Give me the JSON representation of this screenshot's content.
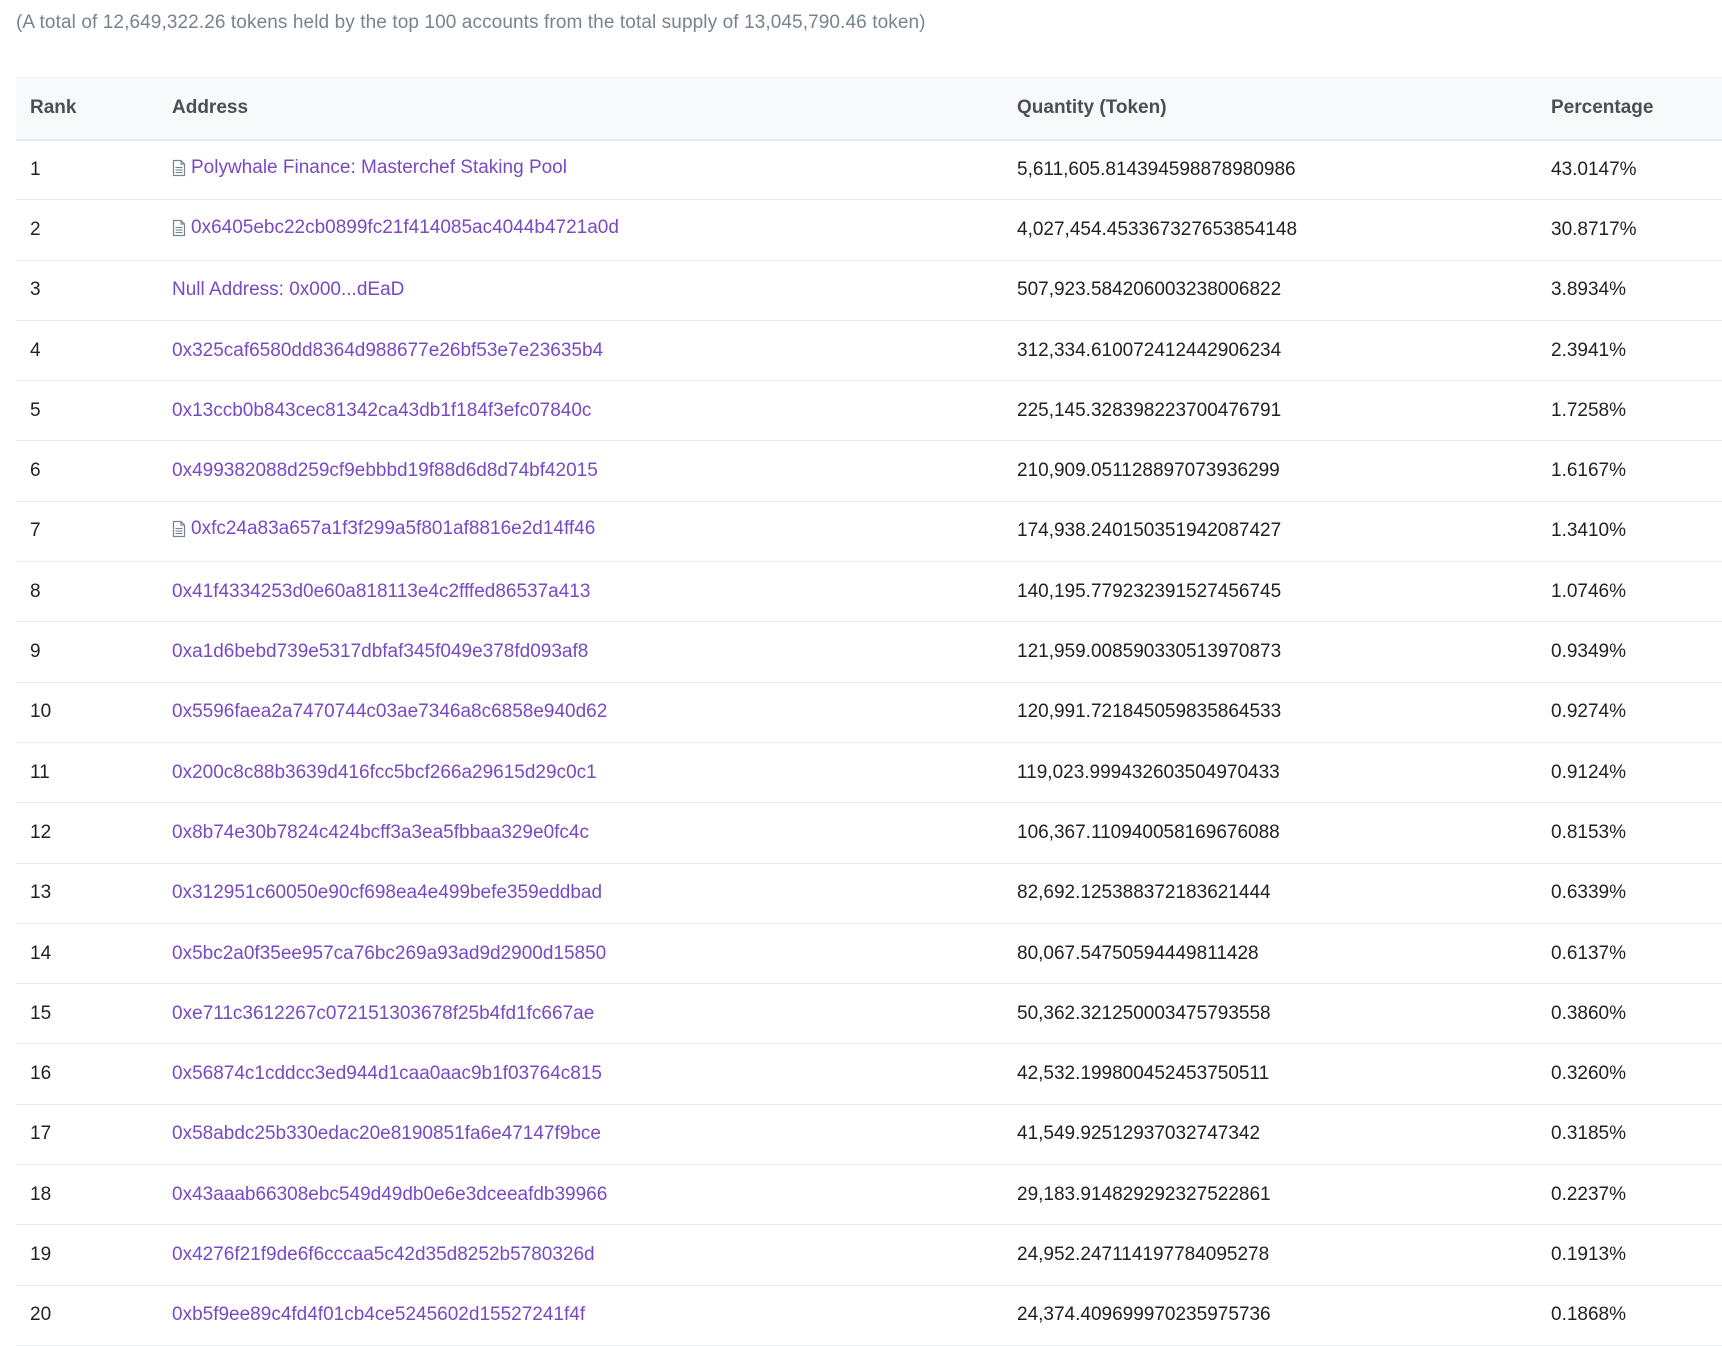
{
  "summary": "(A total of 12,649,322.26 tokens held by the top 100 accounts from the total supply of 13,045,790.46 token)",
  "table": {
    "headers": {
      "rank": "Rank",
      "address": "Address",
      "quantity": "Quantity (Token)",
      "percentage": "Percentage"
    },
    "rows": [
      {
        "rank": "1",
        "address": "Polywhale Finance: Masterchef Staking Pool",
        "contract": true,
        "quantity": "5,611,605.814394598878980986",
        "percentage": "43.0147%"
      },
      {
        "rank": "2",
        "address": "0x6405ebc22cb0899fc21f414085ac4044b4721a0d",
        "contract": true,
        "quantity": "4,027,454.453367327653854148",
        "percentage": "30.8717%"
      },
      {
        "rank": "3",
        "address": "Null Address: 0x000...dEaD",
        "contract": false,
        "quantity": "507,923.584206003238006822",
        "percentage": "3.8934%"
      },
      {
        "rank": "4",
        "address": "0x325caf6580dd8364d988677e26bf53e7e23635b4",
        "contract": false,
        "quantity": "312,334.610072412442906234",
        "percentage": "2.3941%"
      },
      {
        "rank": "5",
        "address": "0x13ccb0b843cec81342ca43db1f184f3efc07840c",
        "contract": false,
        "quantity": "225,145.328398223700476791",
        "percentage": "1.7258%"
      },
      {
        "rank": "6",
        "address": "0x499382088d259cf9ebbbd19f88d6d8d74bf42015",
        "contract": false,
        "quantity": "210,909.051128897073936299",
        "percentage": "1.6167%"
      },
      {
        "rank": "7",
        "address": "0xfc24a83a657a1f3f299a5f801af8816e2d14ff46",
        "contract": true,
        "quantity": "174,938.240150351942087427",
        "percentage": "1.3410%"
      },
      {
        "rank": "8",
        "address": "0x41f4334253d0e60a818113e4c2fffed86537a413",
        "contract": false,
        "quantity": "140,195.779232391527456745",
        "percentage": "1.0746%"
      },
      {
        "rank": "9",
        "address": "0xa1d6bebd739e5317dbfaf345f049e378fd093af8",
        "contract": false,
        "quantity": "121,959.008590330513970873",
        "percentage": "0.9349%"
      },
      {
        "rank": "10",
        "address": "0x5596faea2a7470744c03ae7346a8c6858e940d62",
        "contract": false,
        "quantity": "120,991.721845059835864533",
        "percentage": "0.9274%"
      },
      {
        "rank": "11",
        "address": "0x200c8c88b3639d416fcc5bcf266a29615d29c0c1",
        "contract": false,
        "quantity": "119,023.999432603504970433",
        "percentage": "0.9124%"
      },
      {
        "rank": "12",
        "address": "0x8b74e30b7824c424bcff3a3ea5fbbaa329e0fc4c",
        "contract": false,
        "quantity": "106,367.110940058169676088",
        "percentage": "0.8153%"
      },
      {
        "rank": "13",
        "address": "0x312951c60050e90cf698ea4e499befe359eddbad",
        "contract": false,
        "quantity": "82,692.125388372183621444",
        "percentage": "0.6339%"
      },
      {
        "rank": "14",
        "address": "0x5bc2a0f35ee957ca76bc269a93ad9d2900d15850",
        "contract": false,
        "quantity": "80,067.54750594449811428",
        "percentage": "0.6137%"
      },
      {
        "rank": "15",
        "address": "0xe711c3612267c072151303678f25b4fd1fc667ae",
        "contract": false,
        "quantity": "50,362.321250003475793558",
        "percentage": "0.3860%"
      },
      {
        "rank": "16",
        "address": "0x56874c1cddcc3ed944d1caa0aac9b1f03764c815",
        "contract": false,
        "quantity": "42,532.199800452453750511",
        "percentage": "0.3260%"
      },
      {
        "rank": "17",
        "address": "0x58abdc25b330edac20e8190851fa6e47147f9bce",
        "contract": false,
        "quantity": "41,549.92512937032747342",
        "percentage": "0.3185%"
      },
      {
        "rank": "18",
        "address": "0x43aaab66308ebc549d49db0e6e3dceeafdb39966",
        "contract": false,
        "quantity": "29,183.914829292327522861",
        "percentage": "0.2237%"
      },
      {
        "rank": "19",
        "address": "0x4276f21f9de6f6cccaa5c42d35d8252b5780326d",
        "contract": false,
        "quantity": "24,952.247114197784095278",
        "percentage": "0.1913%"
      },
      {
        "rank": "20",
        "address": "0xb5f9ee89c4fd4f01cb4ce5245602d15527241f4f",
        "contract": false,
        "quantity": "24,374.409699970235975736",
        "percentage": "0.1868%"
      }
    ]
  },
  "colors": {
    "link": "#7749c5",
    "header_bg": "#f8f9fa",
    "muted_text": "#77838f",
    "row_border": "#e7eaf3"
  },
  "icons": {
    "contract": "file-document-icon"
  }
}
